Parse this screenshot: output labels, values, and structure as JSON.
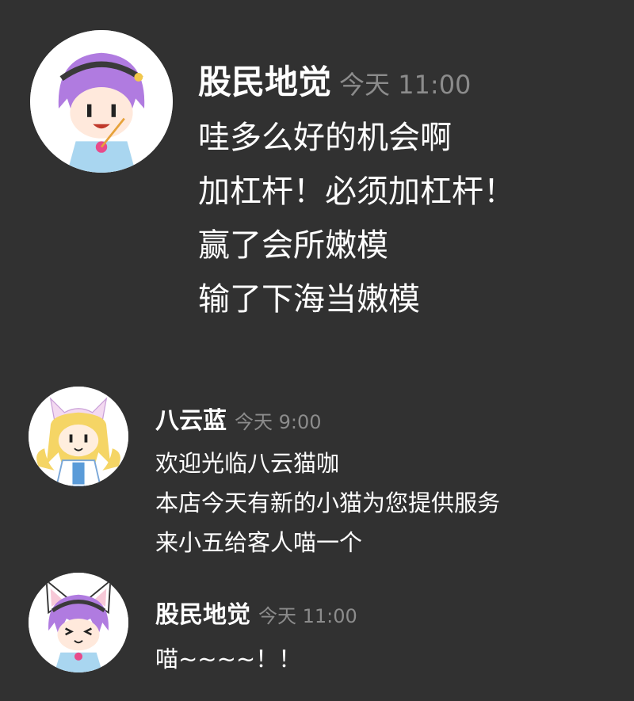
{
  "messages": [
    {
      "sender": "股民地觉",
      "time": "今天 11:00",
      "avatar_icon": "purple-hair-character-avatar-icon",
      "lines": [
        "哇多么好的机会啊",
        "加杠杆！必须加杠杆！",
        "赢了会所嫩模",
        "输了下海当嫩模"
      ]
    },
    {
      "sender": "八云蓝",
      "time": "今天 9:00",
      "avatar_icon": "blonde-fox-character-avatar-icon",
      "lines": [
        "欢迎光临八云猫咖",
        "本店今天有新的小猫为您提供服务",
        "来小五给客人喵一个"
      ]
    },
    {
      "sender": "股民地觉",
      "time": "今天 11:00",
      "avatar_icon": "purple-hair-cat-ears-avatar-icon",
      "lines": [
        "喵~~~~！！"
      ]
    }
  ],
  "colors": {
    "background": "#313131",
    "text": "#ffffff",
    "timestamp": "#8c8c8c"
  }
}
